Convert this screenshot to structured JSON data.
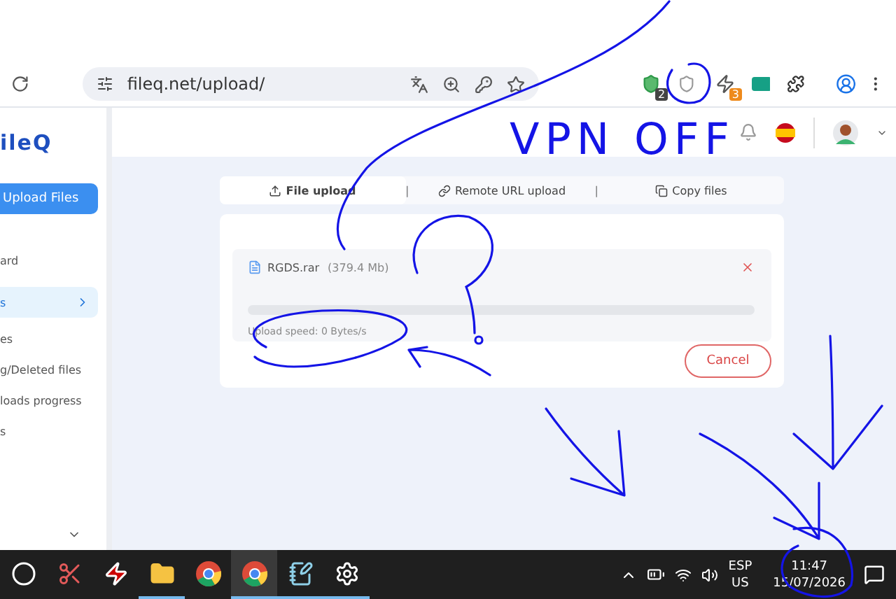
{
  "browser": {
    "url": "fileq.net/upload/",
    "extension_badges": [
      "2",
      "3"
    ]
  },
  "sidebar": {
    "logo": "ileQ",
    "upload_button": "Upload Files",
    "items": [
      {
        "label": "ard",
        "selected": false,
        "expandable": false
      },
      {
        "label": "s",
        "selected": true,
        "expandable": true
      },
      {
        "label": "es",
        "selected": false,
        "expandable": false
      },
      {
        "label": "g/Deleted files",
        "selected": false,
        "expandable": false
      },
      {
        "label": "loads progress",
        "selected": false,
        "expandable": false
      },
      {
        "label": "s",
        "selected": false,
        "expandable": false
      }
    ]
  },
  "tabs": [
    {
      "label": "File upload",
      "selected": true,
      "kind": "upload"
    },
    {
      "label": "Remote URL upload",
      "selected": false,
      "kind": "link"
    },
    {
      "label": "Copy files",
      "selected": false,
      "kind": "copy"
    }
  ],
  "tab_separators": [
    "|",
    "|"
  ],
  "upload": {
    "file_name": "RGDS.rar",
    "file_size": "(379.4 Mb)",
    "level": 0,
    "speed": "Upload speed: 0 Bytes/s",
    "cancel": "Cancel"
  },
  "annotation": {
    "text": "VPN OFF"
  },
  "taskbar": {
    "apps": [
      {
        "kind": "search",
        "running": false,
        "selected": false
      },
      {
        "kind": "snip",
        "running": false,
        "selected": false
      },
      {
        "kind": "flash",
        "running": false,
        "selected": false
      },
      {
        "kind": "folder",
        "running": true,
        "selected": false
      },
      {
        "kind": "chrome",
        "running": false,
        "selected": false
      },
      {
        "kind": "chrome",
        "running": true,
        "selected": true
      },
      {
        "kind": "notes",
        "running": true,
        "selected": false
      },
      {
        "kind": "gear",
        "running": true,
        "selected": false
      }
    ],
    "language": "ESP",
    "layout": "US",
    "time": "11:47",
    "date": "15/07/2026"
  }
}
